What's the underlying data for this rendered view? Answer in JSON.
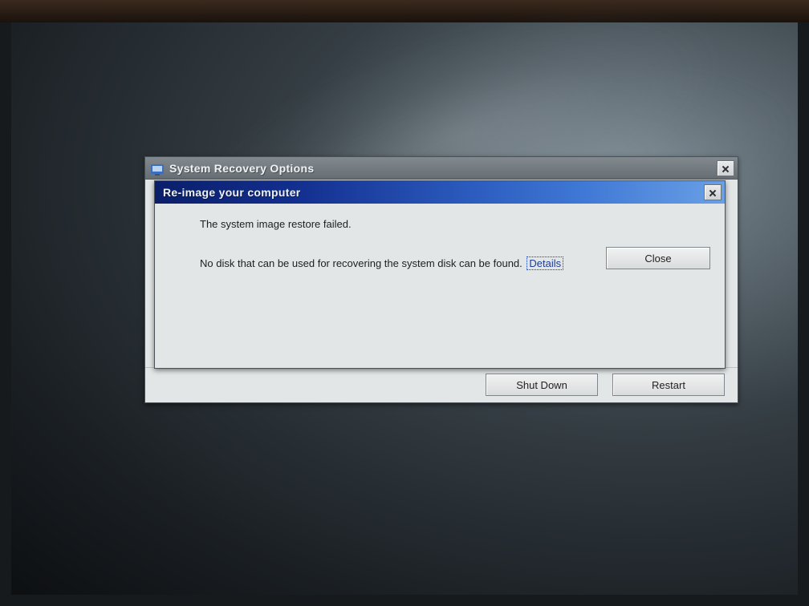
{
  "outer_window": {
    "title": "System Recovery Options",
    "buttons": {
      "shutdown": "Shut Down",
      "restart": "Restart"
    }
  },
  "inner_dialog": {
    "title": "Re-image your computer",
    "message_primary": "The system image restore failed.",
    "message_secondary": "No disk that can be used for recovering the system disk can be found.",
    "details_link": "Details",
    "close_label": "Close"
  }
}
